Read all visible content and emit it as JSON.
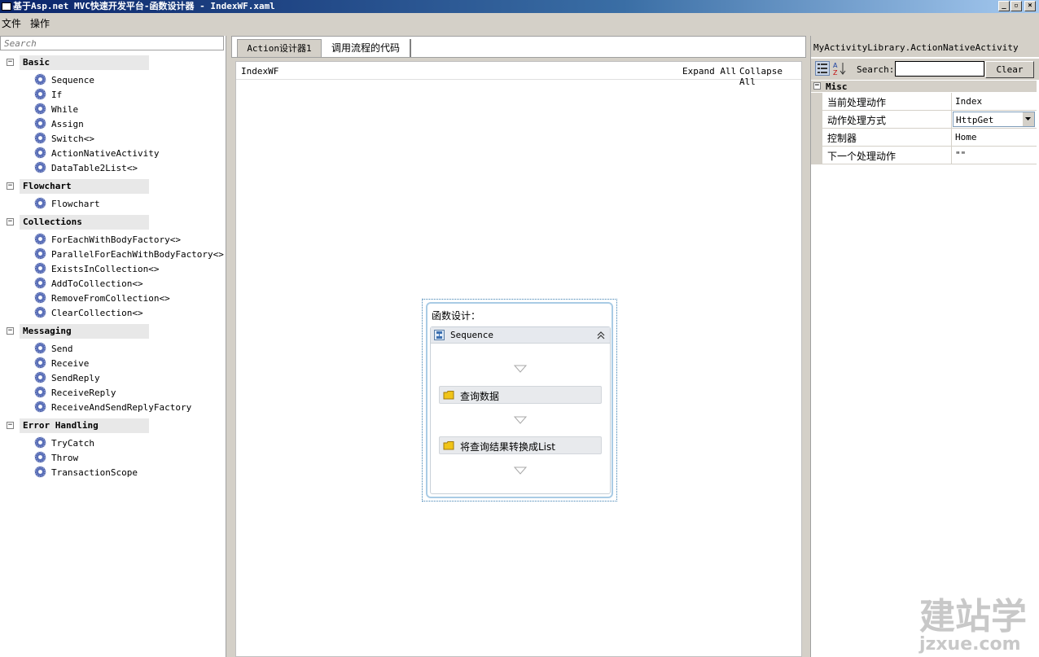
{
  "window": {
    "title": "基于Asp.net MVC快速开发平台-函数设计器 - IndexWF.xaml"
  },
  "menu": {
    "items": [
      "文件",
      "操作"
    ]
  },
  "toolbox": {
    "search_placeholder": "Search",
    "categories": [
      {
        "name": "Basic",
        "items": [
          "Sequence",
          "If",
          "While",
          "Assign",
          "Switch<>",
          "ActionNativeActivity",
          "DataTable2List<>"
        ]
      },
      {
        "name": "Flowchart",
        "items": [
          "Flowchart"
        ]
      },
      {
        "name": "Collections",
        "items": [
          "ForEachWithBodyFactory<>",
          "ParallelForEachWithBodyFactory<>",
          "ExistsInCollection<>",
          "AddToCollection<>",
          "RemoveFromCollection<>",
          "ClearCollection<>"
        ]
      },
      {
        "name": "Messaging",
        "items": [
          "Send",
          "Receive",
          "SendReply",
          "ReceiveReply",
          "ReceiveAndSendReplyFactory"
        ]
      },
      {
        "name": "Error Handling",
        "items": [
          "TryCatch",
          "Throw",
          "TransactionScope"
        ]
      }
    ]
  },
  "tabs": [
    {
      "label": "Action设计器1",
      "active": true
    },
    {
      "label": "调用流程的代码",
      "active": false
    }
  ],
  "designer": {
    "breadcrumb": "IndexWF",
    "expand_all": "Expand All",
    "collapse_all": "Collapse All",
    "workflow": {
      "title": "函数设计：",
      "sequence_label": "Sequence",
      "activities": [
        "查询数据",
        "将查询结果转换成List"
      ]
    }
  },
  "properties": {
    "title": "MyActivityLibrary.ActionNativeActivity",
    "search_label": "Search:",
    "search_value": "",
    "clear_label": "Clear",
    "category": "Misc",
    "rows": [
      {
        "name": "当前处理动作",
        "value": "Index"
      },
      {
        "name": "动作处理方式",
        "value": "HttpGet"
      },
      {
        "name": "控制器",
        "value": "Home"
      },
      {
        "name": "下一个处理动作",
        "value": "\"\""
      }
    ]
  },
  "watermark": {
    "brand": "建站学",
    "domain": "jzxue.com"
  }
}
